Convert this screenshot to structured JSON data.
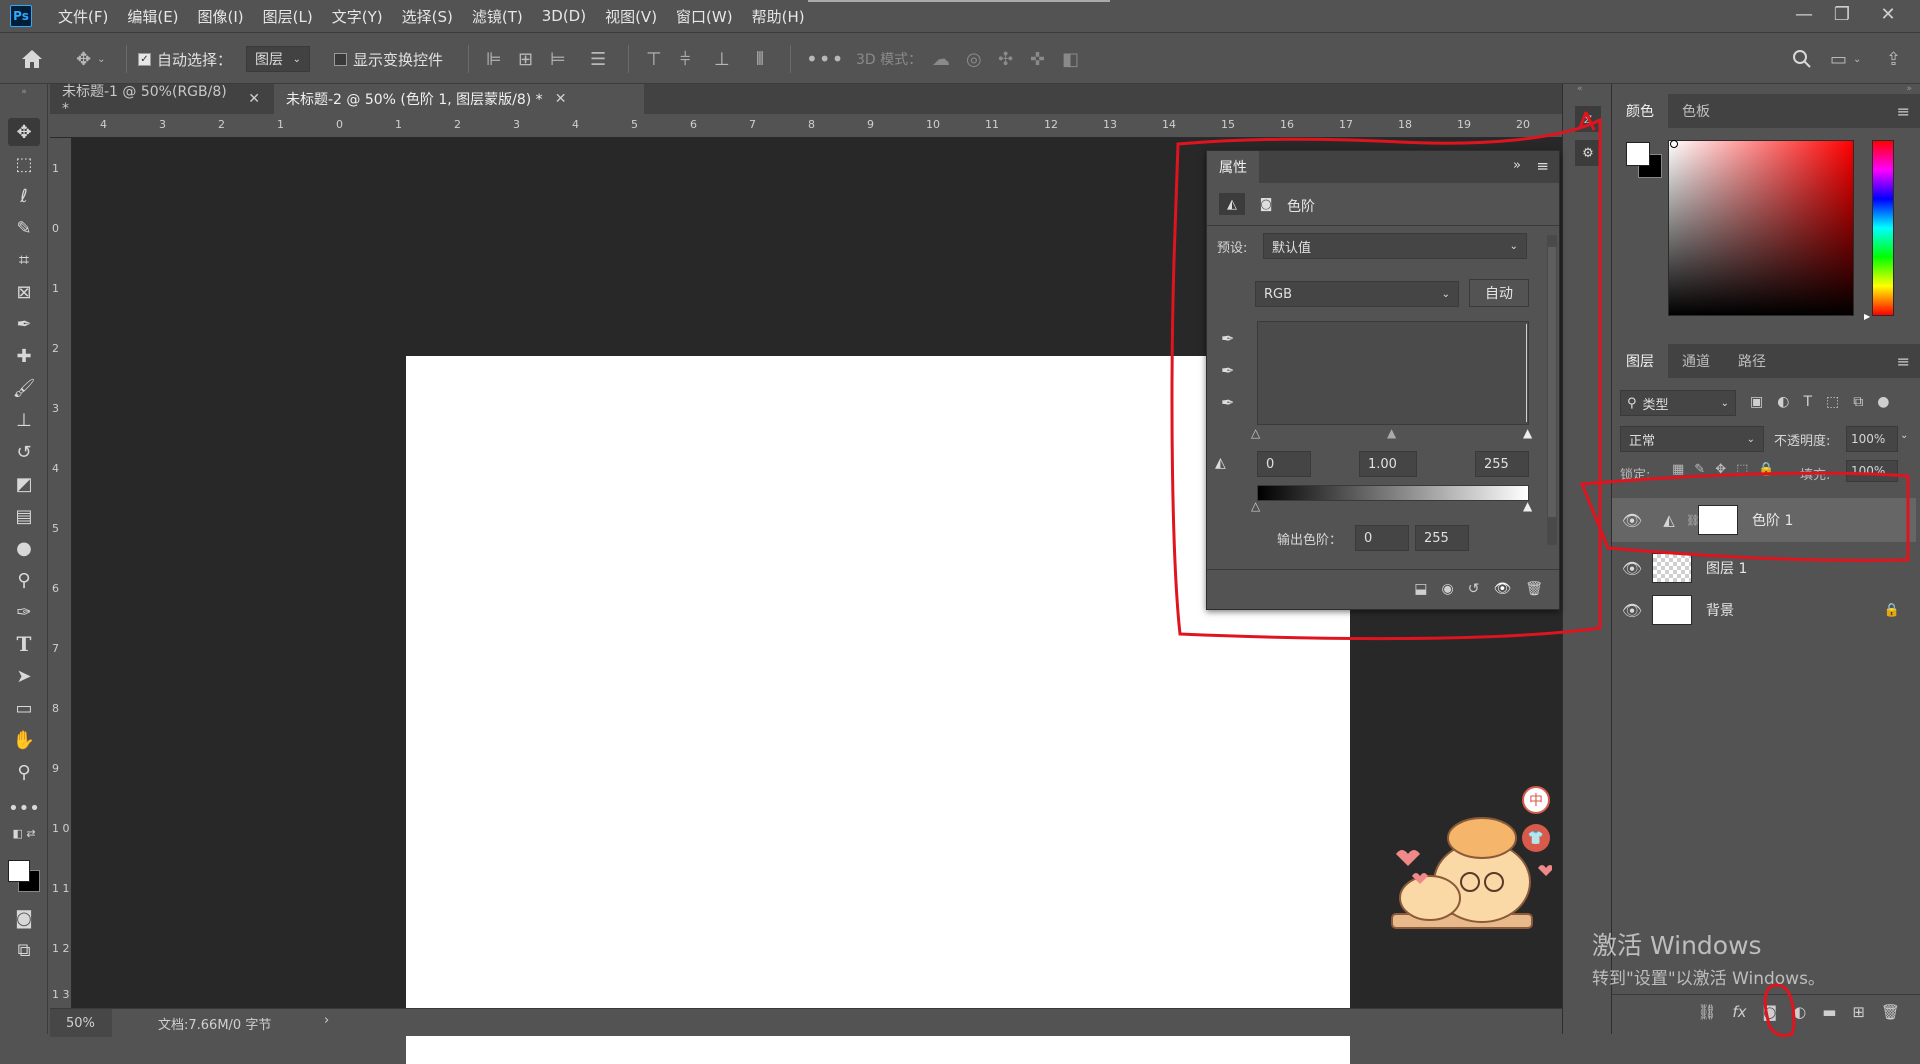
{
  "app": {
    "logo": "Ps"
  },
  "menubar": {
    "items": [
      "文件(F)",
      "编辑(E)",
      "图像(I)",
      "图层(L)",
      "文字(Y)",
      "选择(S)",
      "滤镜(T)",
      "3D(D)",
      "视图(V)",
      "窗口(W)",
      "帮助(H)"
    ],
    "window_controls": {
      "minimize": "—",
      "restore": "❐",
      "close": "✕"
    }
  },
  "options_bar": {
    "auto_select_label": "自动选择：",
    "auto_select_target": "图层",
    "show_transform_label": "显示变换控件",
    "three_d_mode_label": "3D 模式："
  },
  "tabs": [
    {
      "label": "未标题-1 @ 50%(RGB/8) *"
    },
    {
      "label": "未标题-2 @ 50% (色阶 1, 图层蒙版/8) *"
    }
  ],
  "ruler": {
    "h_ticks": [
      "4",
      "3",
      "2",
      "1",
      "0",
      "1",
      "2",
      "3",
      "4",
      "5",
      "6",
      "7",
      "8",
      "9",
      "10",
      "11",
      "12",
      "13",
      "14",
      "15",
      "16",
      "17",
      "18",
      "19",
      "20"
    ],
    "v_ticks": [
      "1",
      "0",
      "1",
      "2",
      "3",
      "4",
      "5",
      "6",
      "7",
      "8",
      "9",
      "1 0",
      "1 1",
      "1 2",
      "1 3"
    ]
  },
  "status": {
    "zoom": "50%",
    "doc_info": "文档:7.66M/0 字节",
    "arrow": "›"
  },
  "properties": {
    "title": "属性",
    "type_label": "色阶",
    "preset_label": "预设:",
    "preset_value": "默认值",
    "channel": "RGB",
    "auto_button": "自动",
    "input_black": "0",
    "input_gamma": "1.00",
    "input_white": "255",
    "output_label": "输出色阶：",
    "output_black": "0",
    "output_white": "255"
  },
  "color_panel": {
    "tabs": [
      "颜色",
      "色板"
    ],
    "hue_colors": [
      "#ff0000",
      "#ff00ff",
      "#0000ff",
      "#00ffff",
      "#00ff00",
      "#ffff00",
      "#ff0000"
    ],
    "picker_hue": "#ff0000"
  },
  "layers_panel": {
    "tabs": [
      "图层",
      "通道",
      "路径"
    ],
    "filter_label": "类型",
    "blend_mode": "正常",
    "opacity_label": "不透明度:",
    "opacity_value": "100%",
    "lock_label": "锁定:",
    "fill_label": "填充:",
    "fill_value": "100%",
    "layers": [
      {
        "name": "色阶 1",
        "selected": true
      },
      {
        "name": "图层 1",
        "selected": false
      },
      {
        "name": "背景",
        "selected": false
      }
    ],
    "footer_fx": "fx"
  },
  "ime_badges": [
    "中",
    "👕"
  ],
  "watermark": {
    "line1": "激活 Windows",
    "line2": "转到\"设置\"以激活 Windows。"
  },
  "annotation_color": "#e0141e",
  "accent": "#31a8ff"
}
